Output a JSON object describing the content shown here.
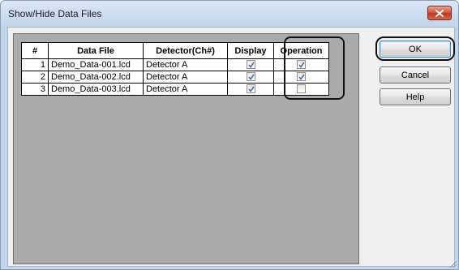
{
  "window": {
    "title": "Show/Hide Data Files",
    "close_icon": "close-icon"
  },
  "table": {
    "headers": [
      "#",
      "Data File",
      "Detector(Ch#)",
      "Display",
      "Operation"
    ],
    "rows": [
      {
        "num": "1",
        "file": "Demo_Data-001.lcd",
        "detector": "Detector A",
        "display": true,
        "operation": true
      },
      {
        "num": "2",
        "file": "Demo_Data-002.lcd",
        "detector": "Detector A",
        "display": true,
        "operation": true
      },
      {
        "num": "3",
        "file": "Demo_Data-003.lcd",
        "detector": "Detector A",
        "display": true,
        "operation": false
      }
    ]
  },
  "buttons": {
    "ok": "OK",
    "cancel": "Cancel",
    "help": "Help"
  },
  "colors": {
    "check": "#4a6fa5",
    "close_button": "#c2361d",
    "highlight_outline": "#111111"
  }
}
